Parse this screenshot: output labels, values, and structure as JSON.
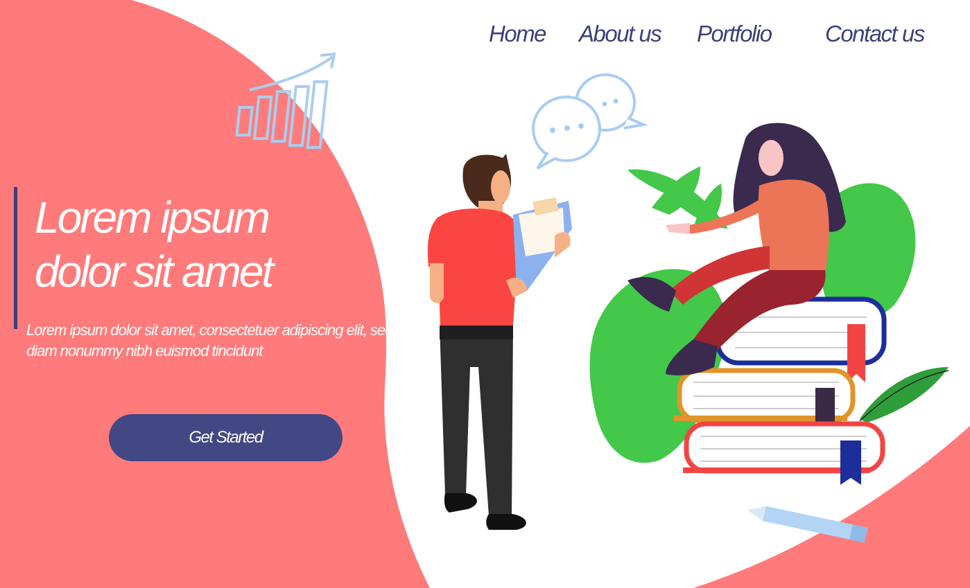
{
  "nav": {
    "items": [
      {
        "label": "Home"
      },
      {
        "label": "About us"
      },
      {
        "label": "Portfolio"
      },
      {
        "label": "Contact us"
      }
    ]
  },
  "hero": {
    "title_line1": "Lorem ipsum",
    "title_line2": "dolor sit amet",
    "description": "Lorem ipsum dolor sit amet, consectetuer adipiscing elit, sed diam nonummy nibh euismod tincidunt",
    "cta_label": "Get Started"
  },
  "colors": {
    "coral": "#ff7b7b",
    "navy": "#414883",
    "nav_text": "#3b3f7a",
    "accent_blue": "#a9cdf0",
    "leaf_green": "#43c84a"
  },
  "icons": [
    "growth-chart-icon",
    "chat-bubbles-icon",
    "pencil-icon",
    "clipboard-icon"
  ]
}
